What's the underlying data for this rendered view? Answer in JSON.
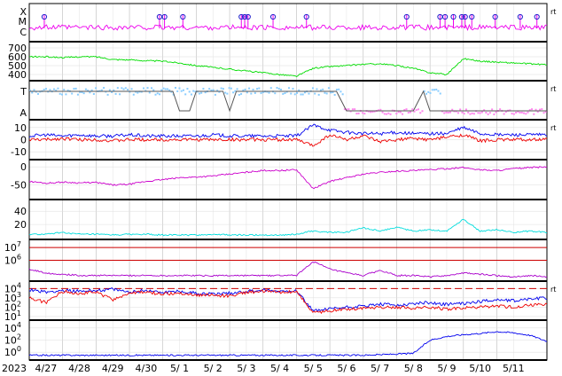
{
  "chart_data": {
    "type": "line",
    "title": "",
    "year_label": "2023",
    "x_ticks": [
      "4/27",
      "4/28",
      "4/29",
      "4/30",
      "5/ 1",
      "5/ 2",
      "5/ 3",
      "5/ 4",
      "5/ 5",
      "5/ 6",
      "5/ 7",
      "5/ 8",
      "5/ 9",
      "5/10",
      "5/11"
    ],
    "x_range_days": [
      0,
      15.5
    ],
    "grid": true,
    "right_tag": "rt",
    "colors": {
      "flare": "#ee00ee",
      "wind_speed": "#00dd00",
      "cyan": "#88ccff",
      "pink": "#ff88ee",
      "gray": "#555555",
      "blue": "#0000ee",
      "red": "#ee0000",
      "magenta": "#cc00cc",
      "turq": "#00dddd",
      "purple": "#aa00cc",
      "refline": "#cc0000"
    },
    "panels": [
      {
        "name": "flare-panel",
        "yticks": [
          "X",
          "M",
          "C"
        ],
        "right_tag": true,
        "flare_markers_x_days": [
          0.45,
          3.9,
          4.05,
          4.6,
          6.35,
          6.45,
          6.55,
          7.3,
          8.3,
          11.3,
          12.3,
          12.45,
          12.7,
          12.95,
          13.05,
          13.25,
          13.95,
          14.7,
          15.2
        ]
      },
      {
        "name": "wind-speed-panel",
        "yticks": [
          "700",
          "600",
          "500",
          "400"
        ],
        "ylim": [
          350,
          750
        ],
        "series": [
          {
            "color": "green",
            "values": [
              600,
              600,
              590,
              600,
              600,
              570,
              565,
              555,
              550,
              530,
              500,
              480,
              460,
              440,
              420,
              400,
              380,
              470,
              490,
              500,
              515,
              520,
              500,
              470,
              420,
              400,
              580,
              550,
              540,
              530,
              520,
              510
            ]
          }
        ]
      },
      {
        "name": "field-direction-panel",
        "yticks": [
          "T",
          "A"
        ],
        "right_tag": true
      },
      {
        "name": "imf-panel",
        "yticks": [
          "10",
          "0",
          "-10"
        ],
        "ylim": [
          -15,
          15
        ],
        "right_tag": true,
        "series": [
          {
            "color": "blue",
            "values": [
              3,
              4,
              3,
              4,
              3,
              3,
              4,
              3,
              3,
              3,
              3,
              4,
              3,
              3,
              3,
              3,
              3,
              12,
              8,
              6,
              5,
              5,
              6,
              5,
              5,
              5,
              10,
              5,
              4,
              4,
              4,
              4
            ]
          },
          {
            "color": "red",
            "values": [
              0,
              0,
              1,
              0,
              0,
              -1,
              0,
              0,
              0,
              0,
              0,
              0,
              0,
              0,
              0,
              0,
              0,
              -5,
              4,
              0,
              3,
              -2,
              0,
              1,
              0,
              2,
              4,
              -1,
              0,
              0,
              0,
              0
            ]
          }
        ]
      },
      {
        "name": "dst-panel",
        "yticks": [
          "0",
          "-50"
        ],
        "ylim": [
          -85,
          15
        ],
        "series": [
          {
            "color": "magenta",
            "values": [
              -40,
              -45,
              -42,
              -44,
              -43,
              -50,
              -48,
              -40,
              -35,
              -30,
              -28,
              -25,
              -20,
              -15,
              -10,
              -10,
              -8,
              -60,
              -40,
              -30,
              -20,
              -15,
              -12,
              -10,
              -8,
              -5,
              -2,
              -8,
              -10,
              -5,
              -2,
              0
            ]
          }
        ]
      },
      {
        "name": "index-panel",
        "yticks": [
          "40",
          "20"
        ],
        "ylim": [
          0,
          55
        ],
        "series": [
          {
            "color": "turq",
            "values": [
              5,
              5,
              8,
              5,
              5,
              4,
              5,
              5,
              4,
              4,
              4,
              5,
              4,
              4,
              4,
              4,
              5,
              10,
              8,
              8,
              15,
              10,
              16,
              10,
              12,
              10,
              28,
              10,
              12,
              8,
              10,
              8
            ]
          }
        ]
      },
      {
        "name": "electron-flux-panel",
        "yticks": [
          "10^7",
          "10^6"
        ],
        "log_range": [
          4.5,
          7.5
        ],
        "ref_lines": [
          7,
          6
        ],
        "series": [
          {
            "color": "purple",
            "values_log": [
              5.3,
              5.0,
              4.9,
              4.8,
              4.8,
              4.8,
              4.8,
              4.8,
              4.8,
              4.8,
              4.8,
              4.8,
              4.8,
              4.8,
              4.8,
              4.8,
              4.8,
              5.9,
              5.3,
              5.0,
              4.8,
              5.2,
              4.8,
              4.8,
              4.7,
              4.8,
              5.0,
              4.9,
              4.8,
              4.7,
              4.8,
              4.7
            ]
          }
        ]
      },
      {
        "name": "proton-flux-panel",
        "yticks": [
          "10^4",
          "10^3",
          "10^2",
          "10^1"
        ],
        "log_range": [
          0.8,
          4.6
        ],
        "ref_lines": [
          4
        ],
        "right_tag": true,
        "series": [
          {
            "color": "blue",
            "values_log": [
              3.9,
              3.6,
              3.8,
              3.7,
              3.8,
              3.9,
              3.6,
              3.8,
              3.6,
              3.7,
              3.5,
              3.4,
              3.5,
              3.7,
              3.8,
              3.7,
              3.8,
              1.6,
              1.8,
              2.0,
              2.1,
              2.3,
              2.2,
              2.4,
              2.5,
              2.3,
              2.4,
              2.6,
              2.8,
              2.7,
              2.9,
              3.0
            ]
          },
          {
            "color": "red",
            "values_log": [
              3.0,
              2.5,
              3.7,
              3.5,
              3.6,
              2.8,
              3.5,
              3.6,
              3.4,
              3.5,
              3.3,
              3.3,
              3.2,
              3.6,
              3.7,
              3.6,
              3.7,
              1.4,
              1.6,
              1.8,
              1.9,
              2.0,
              2.0,
              1.9,
              2.0,
              1.8,
              1.9,
              2.0,
              2.1,
              2.0,
              2.2,
              2.3
            ]
          }
        ]
      },
      {
        "name": "neutron-panel",
        "yticks": [
          "10^4",
          "10^2",
          "10^0"
        ],
        "log_range": [
          -1,
          5
        ],
        "series": [
          {
            "color": "blue",
            "values_log": [
              -0.5,
              -0.5,
              -0.5,
              -0.5,
              -0.5,
              -0.5,
              -0.5,
              -0.5,
              -0.5,
              -0.5,
              -0.5,
              -0.5,
              -0.5,
              -0.5,
              -0.5,
              -0.5,
              -0.5,
              -0.5,
              -0.5,
              -0.5,
              -0.5,
              -0.4,
              -0.3,
              -0.2,
              2.0,
              2.6,
              2.9,
              3.1,
              3.4,
              3.2,
              2.8,
              1.8
            ]
          }
        ]
      }
    ]
  }
}
